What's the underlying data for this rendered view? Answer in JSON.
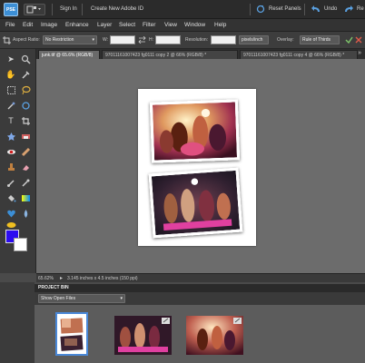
{
  "titlebar": {
    "logo": "PSE",
    "sign_in": "Sign In",
    "create_account": "Create New Adobe ID",
    "reset_panels": "Reset Panels",
    "undo": "Undo",
    "redo": "Re"
  },
  "menu": [
    "File",
    "Edit",
    "Image",
    "Enhance",
    "Layer",
    "Select",
    "Filter",
    "View",
    "Window",
    "Help"
  ],
  "options": {
    "aspect_label": "Aspect Ratio:",
    "aspect_value": "No Restriction",
    "width_label": "W:",
    "height_label": "H:",
    "resolution_label": "Resolution:",
    "resolution_unit": "pixels/inch",
    "overlay_label": "Overlay:",
    "overlay_value": "Rule of Thirds"
  },
  "tabs": [
    "junk.tif @ 65.6% (RGB/8)",
    "97011161007423 fg0111 copy 2 @ 66% (RGB/8) *",
    "97011161007423 fg0111 copy 4 @ 66% (RGB/8) *"
  ],
  "status": {
    "zoom": "65.62%",
    "doc_info": "3.145 inches x 4.5 inches (150 ppi)"
  },
  "bin": {
    "title": "PROJECT BIN",
    "show": "Show Open Files"
  },
  "colors": {
    "foreground": "#2c0cf0",
    "background": "#ffffff"
  }
}
